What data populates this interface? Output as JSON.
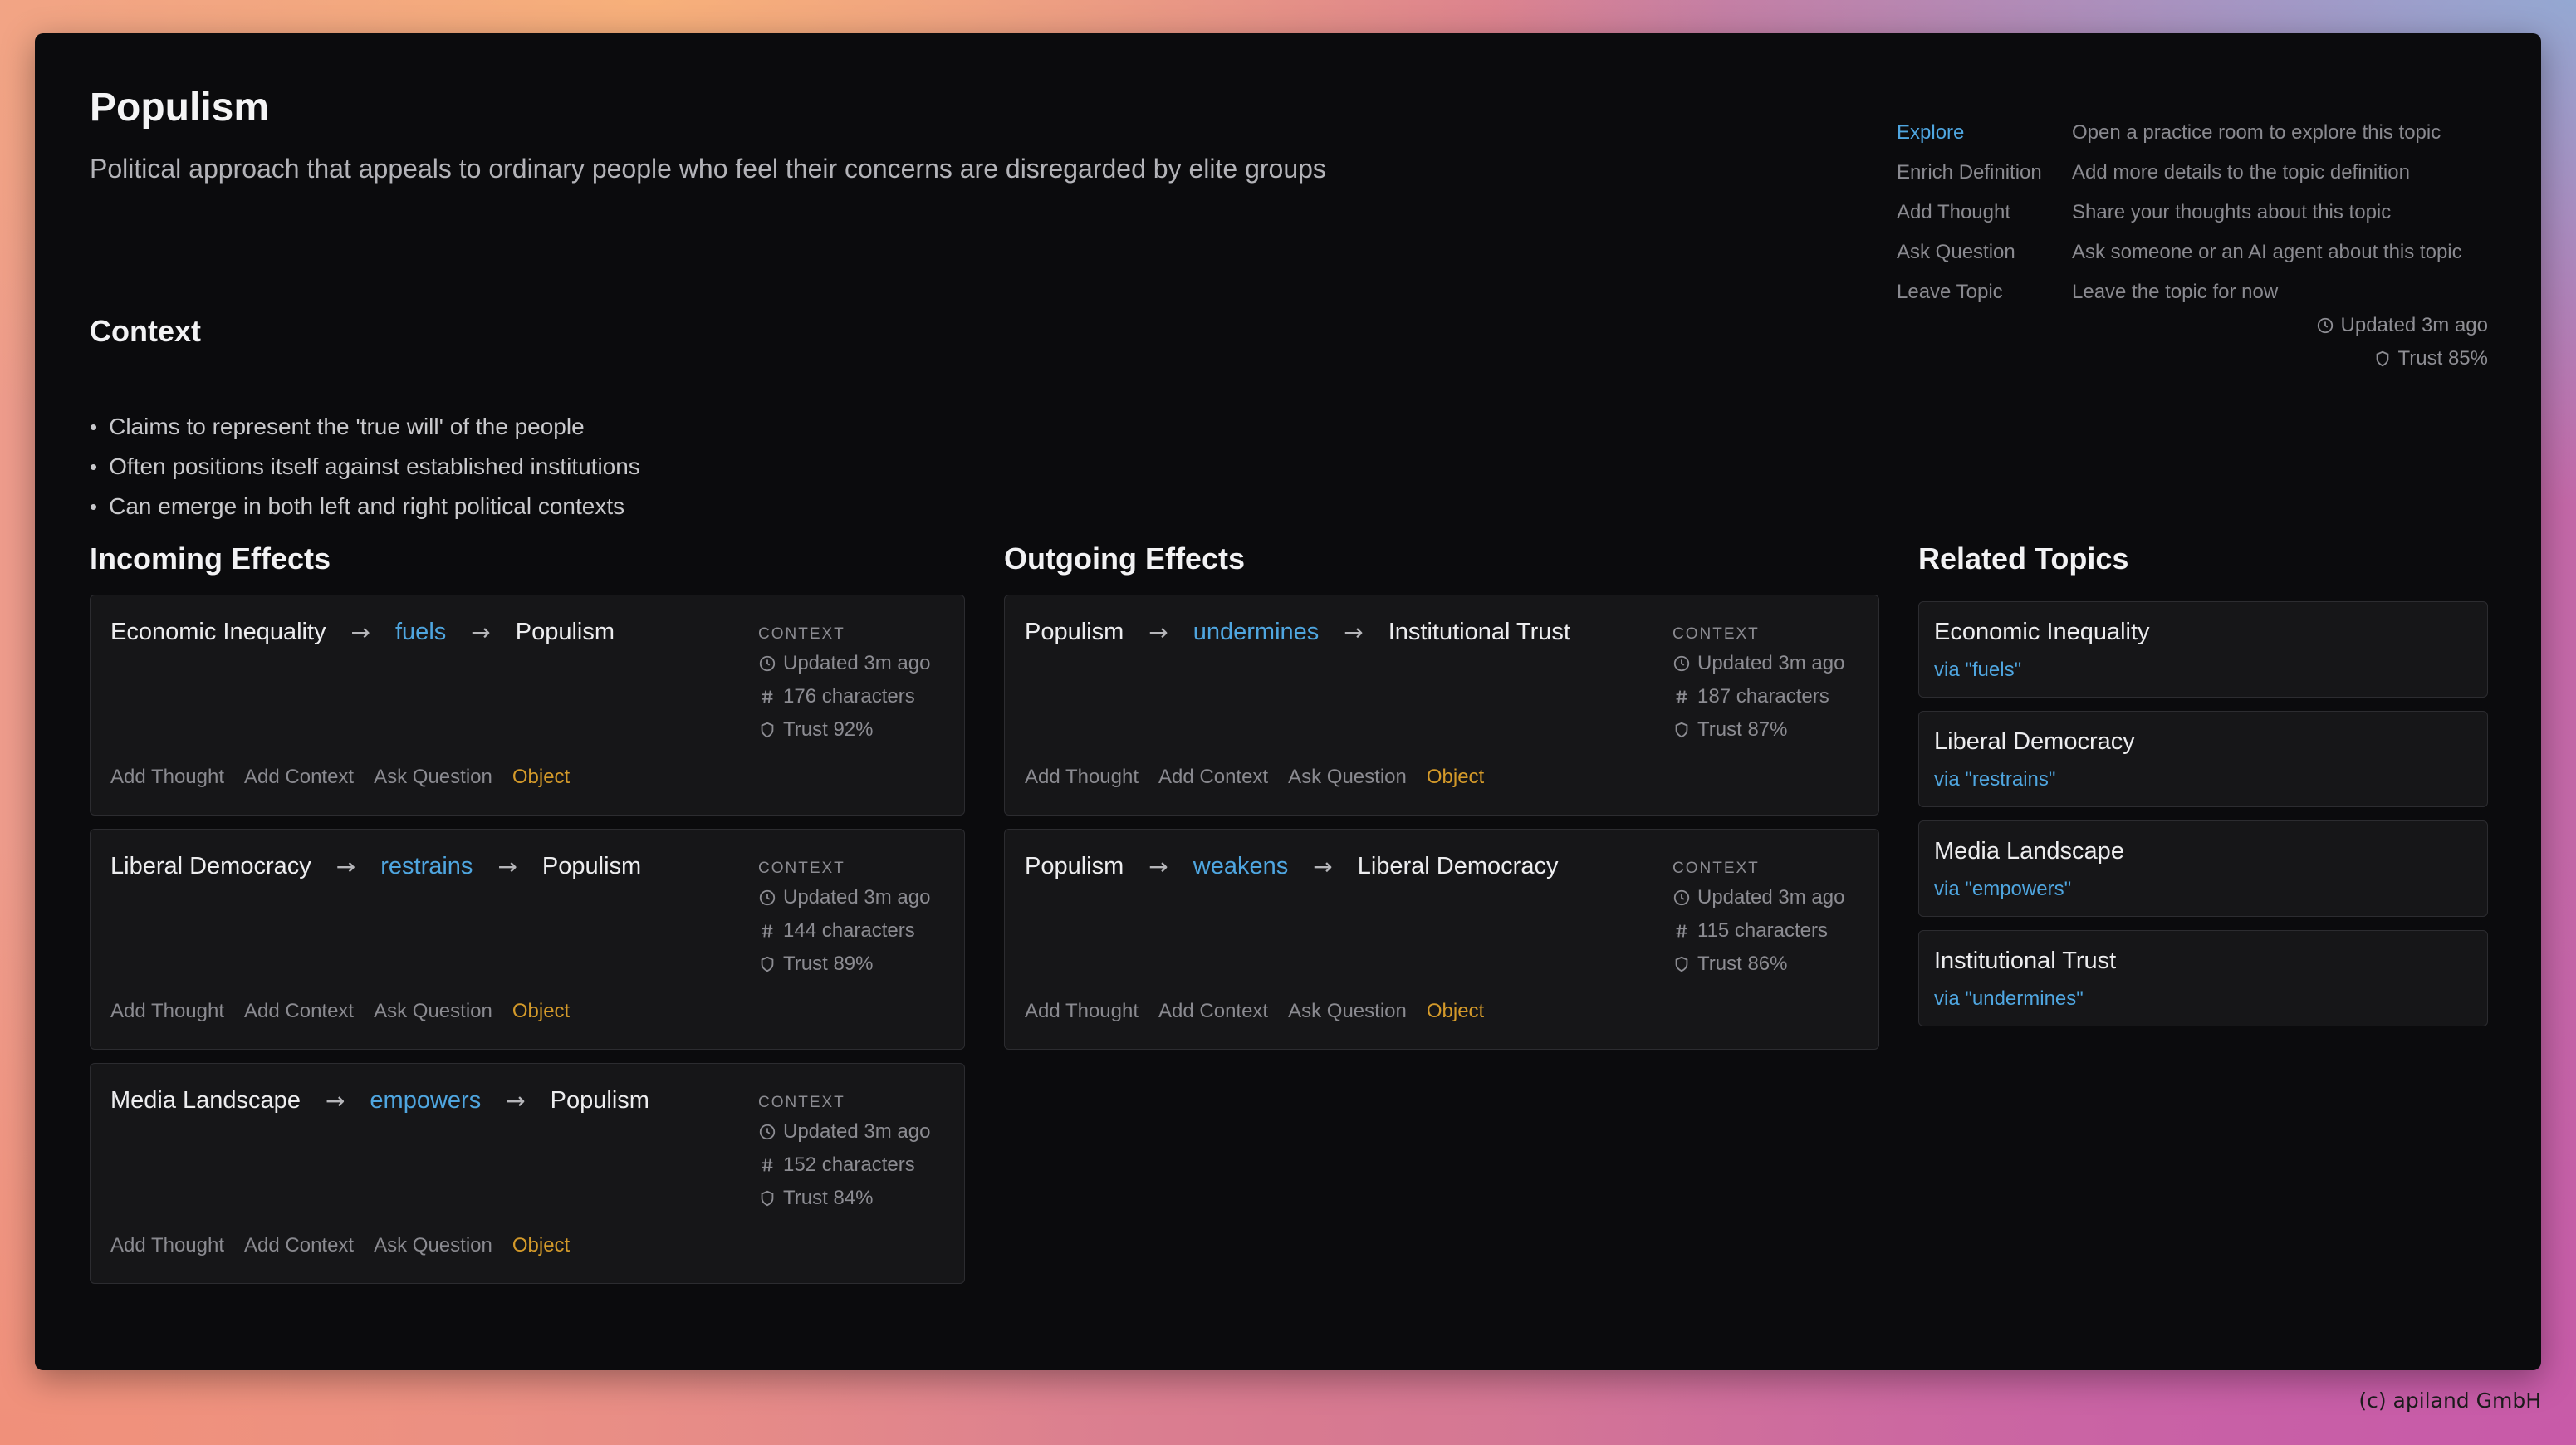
{
  "topic": {
    "title": "Populism",
    "description": "Political approach that appeals to ordinary people who feel their concerns are disregarded by elite groups"
  },
  "actions": [
    {
      "name": "Explore",
      "hint": "Open a practice room to explore this topic",
      "active": true
    },
    {
      "name": "Enrich Definition",
      "hint": "Add more details to the topic definition"
    },
    {
      "name": "Add Thought",
      "hint": "Share your thoughts about this topic"
    },
    {
      "name": "Ask Question",
      "hint": "Ask someone or an AI agent about this topic"
    },
    {
      "name": "Leave Topic",
      "hint": "Leave the topic for now"
    }
  ],
  "topic_meta": {
    "updated": "Updated 3m ago",
    "trust": "Trust 85%"
  },
  "context": {
    "heading": "Context",
    "items": [
      "Claims to represent the 'true will' of the people",
      "Often positions itself against established institutions",
      "Can emerge in both left and right political contexts"
    ]
  },
  "card_labels": {
    "context": "CONTEXT",
    "add_thought": "Add Thought",
    "add_context": "Add Context",
    "ask_question": "Ask Question",
    "object": "Object"
  },
  "incoming": {
    "heading": "Incoming Effects",
    "cards": [
      {
        "source": "Economic Inequality",
        "verb": "fuels",
        "target": "Populism",
        "updated": "Updated 3m ago",
        "chars": "176 characters",
        "trust": "Trust 92%"
      },
      {
        "source": "Liberal Democracy",
        "verb": "restrains",
        "target": "Populism",
        "updated": "Updated 3m ago",
        "chars": "144 characters",
        "trust": "Trust 89%"
      },
      {
        "source": "Media Landscape",
        "verb": "empowers",
        "target": "Populism",
        "updated": "Updated 3m ago",
        "chars": "152 characters",
        "trust": "Trust 84%"
      }
    ]
  },
  "outgoing": {
    "heading": "Outgoing Effects",
    "cards": [
      {
        "source": "Populism",
        "verb": "undermines",
        "target": "Institutional Trust",
        "updated": "Updated 3m ago",
        "chars": "187 characters",
        "trust": "Trust 87%"
      },
      {
        "source": "Populism",
        "verb": "weakens",
        "target": "Liberal Democracy",
        "updated": "Updated 3m ago",
        "chars": "115 characters",
        "trust": "Trust 86%"
      }
    ]
  },
  "related": {
    "heading": "Related Topics",
    "items": [
      {
        "title": "Economic Inequality",
        "via": "via \"fuels\""
      },
      {
        "title": "Liberal Democracy",
        "via": "via \"restrains\""
      },
      {
        "title": "Media Landscape",
        "via": "via \"empowers\""
      },
      {
        "title": "Institutional Trust",
        "via": "via \"undermines\""
      }
    ]
  },
  "footer": {
    "copyright": "(c) apiland GmbH"
  },
  "icons": {
    "arrow": "arrow-right-icon",
    "clock": "clock-icon",
    "hash": "hash-icon",
    "shield": "shield-icon"
  },
  "colors": {
    "accent": "#4fa6e0",
    "object": "#d49a2a",
    "panel": "#0b0b0d",
    "card": "#161618"
  }
}
